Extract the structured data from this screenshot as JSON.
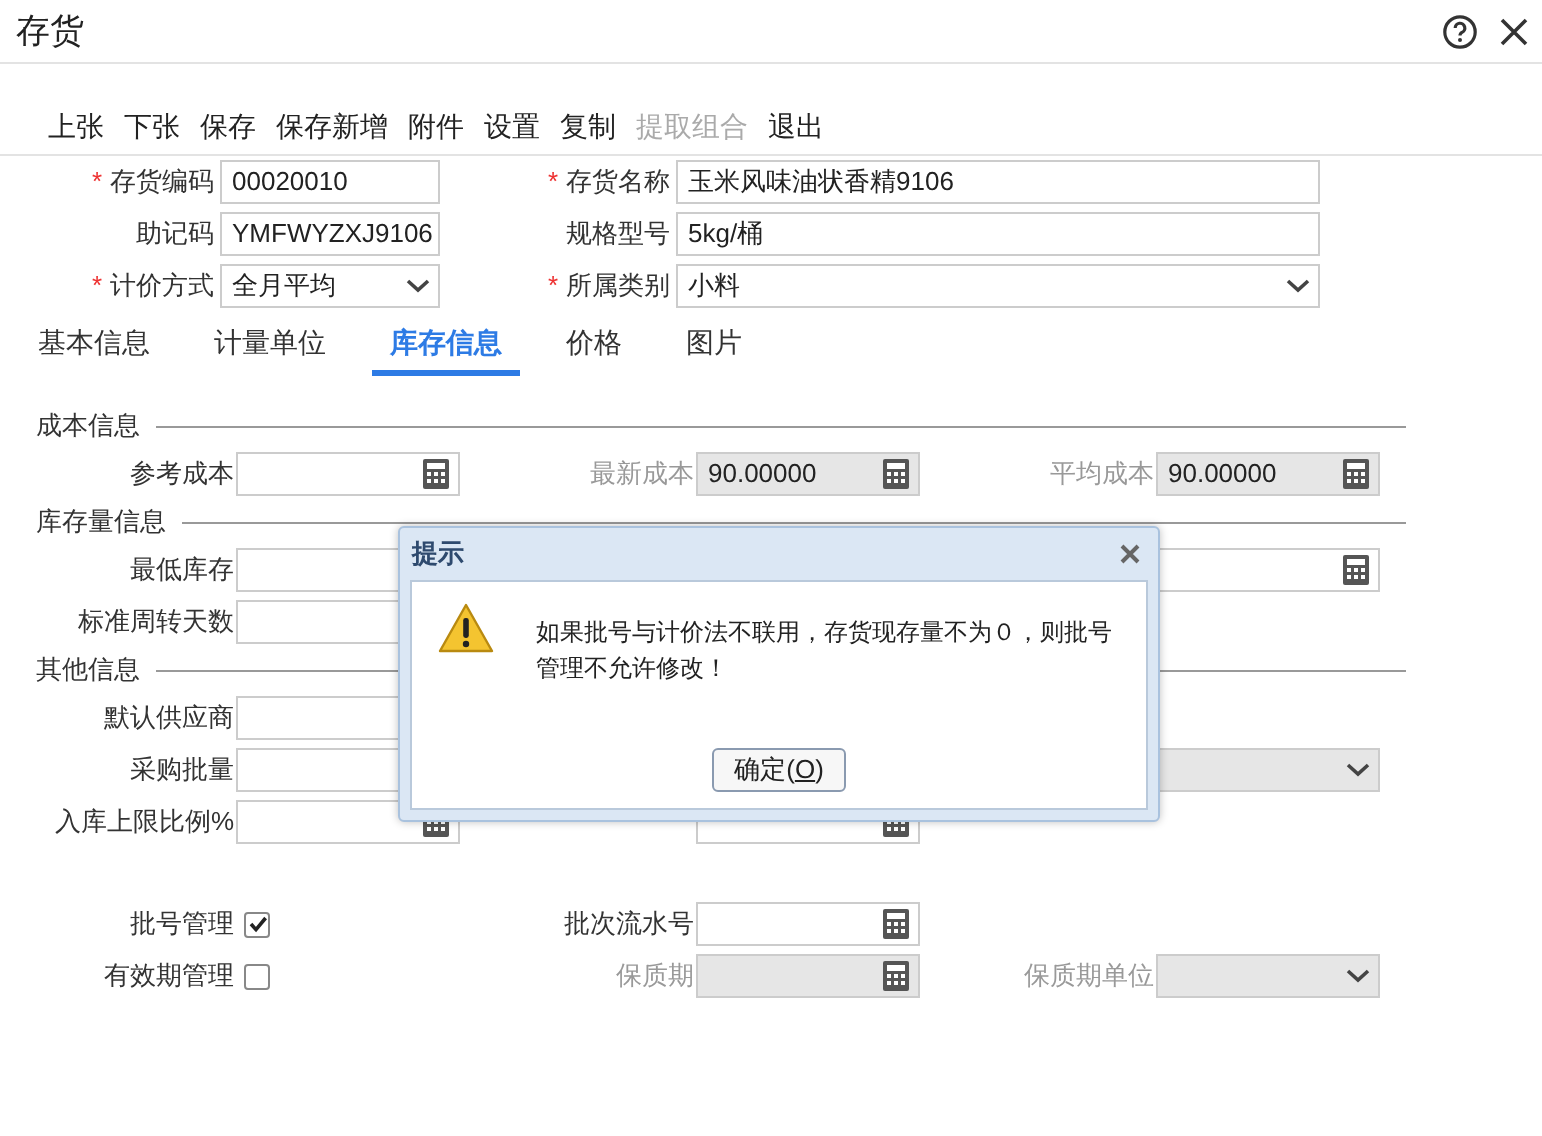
{
  "window": {
    "title": "存货"
  },
  "toolbar": [
    {
      "label": "上张",
      "disabled": false
    },
    {
      "label": "下张",
      "disabled": false
    },
    {
      "label": "保存",
      "disabled": false
    },
    {
      "label": "保存新增",
      "disabled": false
    },
    {
      "label": "附件",
      "disabled": false
    },
    {
      "label": "设置",
      "disabled": false
    },
    {
      "label": "复制",
      "disabled": false
    },
    {
      "label": "提取组合",
      "disabled": true
    },
    {
      "label": "退出",
      "disabled": false
    }
  ],
  "header_rows": [
    [
      {
        "required_mark": "*",
        "label": "存货编码",
        "kind": "text",
        "value": "00020010"
      },
      {
        "required_mark": "*",
        "label": "存货名称",
        "kind": "text",
        "value": "玉米风味油状香精9106"
      }
    ],
    [
      {
        "label": "助记码",
        "kind": "text",
        "value": "YMFWYZXJ9106"
      },
      {
        "label": "规格型号",
        "kind": "text",
        "value": "5kg/桶"
      }
    ],
    [
      {
        "required_mark": "*",
        "label": "计价方式",
        "kind": "select",
        "value": "全月平均"
      },
      {
        "required_mark": "*",
        "label": "所属类别",
        "kind": "select",
        "value": "小料"
      }
    ]
  ],
  "tabs": [
    {
      "label": "基本信息",
      "selected": false
    },
    {
      "label": "计量单位",
      "selected": false
    },
    {
      "label": "库存信息",
      "selected": true
    },
    {
      "label": "价格",
      "selected": false
    },
    {
      "label": "图片",
      "selected": false
    }
  ],
  "sections": [
    {
      "title": "成本信息",
      "rows": [
        [
          {
            "label": "参考成本",
            "kind": "calc",
            "disabled": false
          },
          {
            "label": "最新成本",
            "kind": "calc",
            "value": "90.00000",
            "disabled": true
          },
          {
            "label": "平均成本",
            "kind": "calc",
            "value": "90.00000",
            "disabled": true
          }
        ]
      ]
    },
    {
      "title": "库存量信息",
      "rows": [
        [
          {
            "label": "最低库存",
            "kind": "text",
            "disabled": false
          },
          null,
          {
            "kind": "calc",
            "disabled": false
          }
        ],
        [
          {
            "label": "标准周转天数",
            "kind": "text",
            "disabled": false
          }
        ]
      ]
    },
    {
      "title": "其他信息",
      "rows": [
        [
          {
            "label": "默认供应商",
            "kind": "text",
            "disabled": false
          }
        ],
        [
          {
            "label": "采购批量",
            "kind": "text",
            "disabled": false
          },
          null,
          {
            "kind": "select",
            "disabled": true
          }
        ],
        [
          {
            "label": "入库上限比例%",
            "kind": "calc",
            "disabled": false
          },
          {
            "kind": "calc",
            "disabled": false
          }
        ]
      ]
    },
    {
      "rows": [
        [
          {
            "label": "批号管理",
            "kind": "checkbox",
            "checked": true
          },
          {
            "label": "批次流水号",
            "kind": "calc",
            "disabled": false
          }
        ],
        [
          {
            "label": "有效期管理",
            "kind": "checkbox",
            "checked": false
          },
          {
            "label": "保质期",
            "kind": "calc",
            "disabled": true
          },
          {
            "label": "保质期单位",
            "kind": "select",
            "disabled": true
          }
        ]
      ]
    }
  ],
  "dialog": {
    "title": "提示",
    "message": "如果批号与计价法不联用，存货现存量不为０，则批号管理不允许修改！",
    "button": {
      "text_before": "确定(",
      "underlined": "O",
      "text_after": ")"
    }
  }
}
